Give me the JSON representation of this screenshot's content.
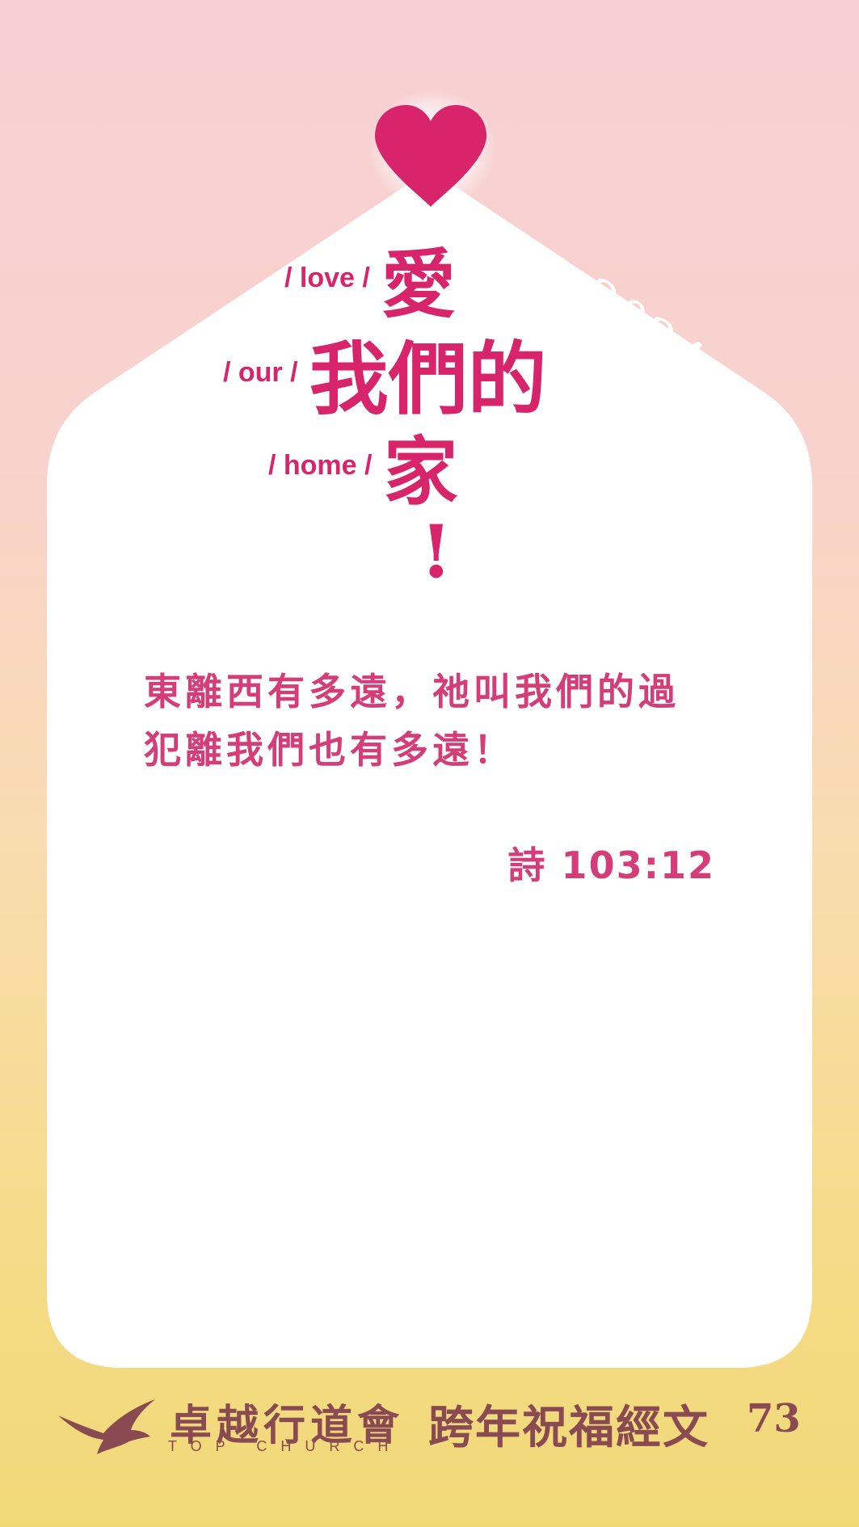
{
  "year": "2024",
  "title": {
    "row1_en": "/ love /",
    "row1_zh": "愛",
    "row2_en": "/ our /",
    "row2_zh": "我們的",
    "row3_en": "/ home /",
    "row3_zh": "家",
    "exclaim": "!"
  },
  "verse": {
    "line1": "東離西有多遠，祂叫我們的過",
    "line2": "犯離我們也有多遠！",
    "reference": "詩 103:12"
  },
  "footer": {
    "org_zh": "卓越行道會",
    "org_en": "TOP CHURCH",
    "book_title": "跨年祝福經文",
    "page_number": "73"
  },
  "colors": {
    "accent": "#d8246a",
    "verse": "#d43d78",
    "footer_text": "#8a4a52"
  },
  "icons": [
    "heart-icon",
    "eagle-logo-icon"
  ]
}
